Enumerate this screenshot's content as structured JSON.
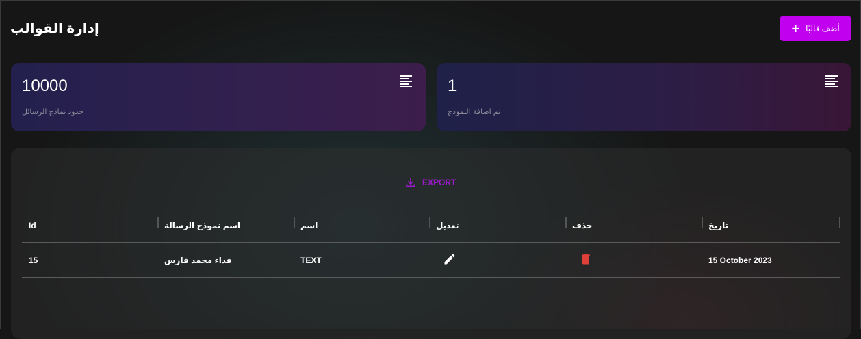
{
  "header": {
    "title": "إدارة القوالب",
    "add_button_label": "أضف قالبًا",
    "add_icon": "plus-icon"
  },
  "stats": [
    {
      "value": "10000",
      "label": "حدود نماذج الرسائل",
      "icon": "list-icon"
    },
    {
      "value": "1",
      "label": "تم اضافة النموذج",
      "icon": "list-icon"
    }
  ],
  "toolbar": {
    "export_label": "EXPORT",
    "export_icon": "download-icon"
  },
  "table": {
    "columns": [
      "Id",
      "اسم نموذج الرسالة",
      "اسم",
      "تعديل",
      "حذف",
      "تاريخ"
    ],
    "rows": [
      {
        "id": "15",
        "template_name": "فداء محمد فارس",
        "name": "TEXT",
        "edit_icon": "pencil-icon",
        "delete_icon": "trash-icon",
        "date": "15 October 2023"
      }
    ]
  },
  "colors": {
    "accent": "#c100f0",
    "export": "#9e19cf",
    "delete": "#e0403a"
  }
}
